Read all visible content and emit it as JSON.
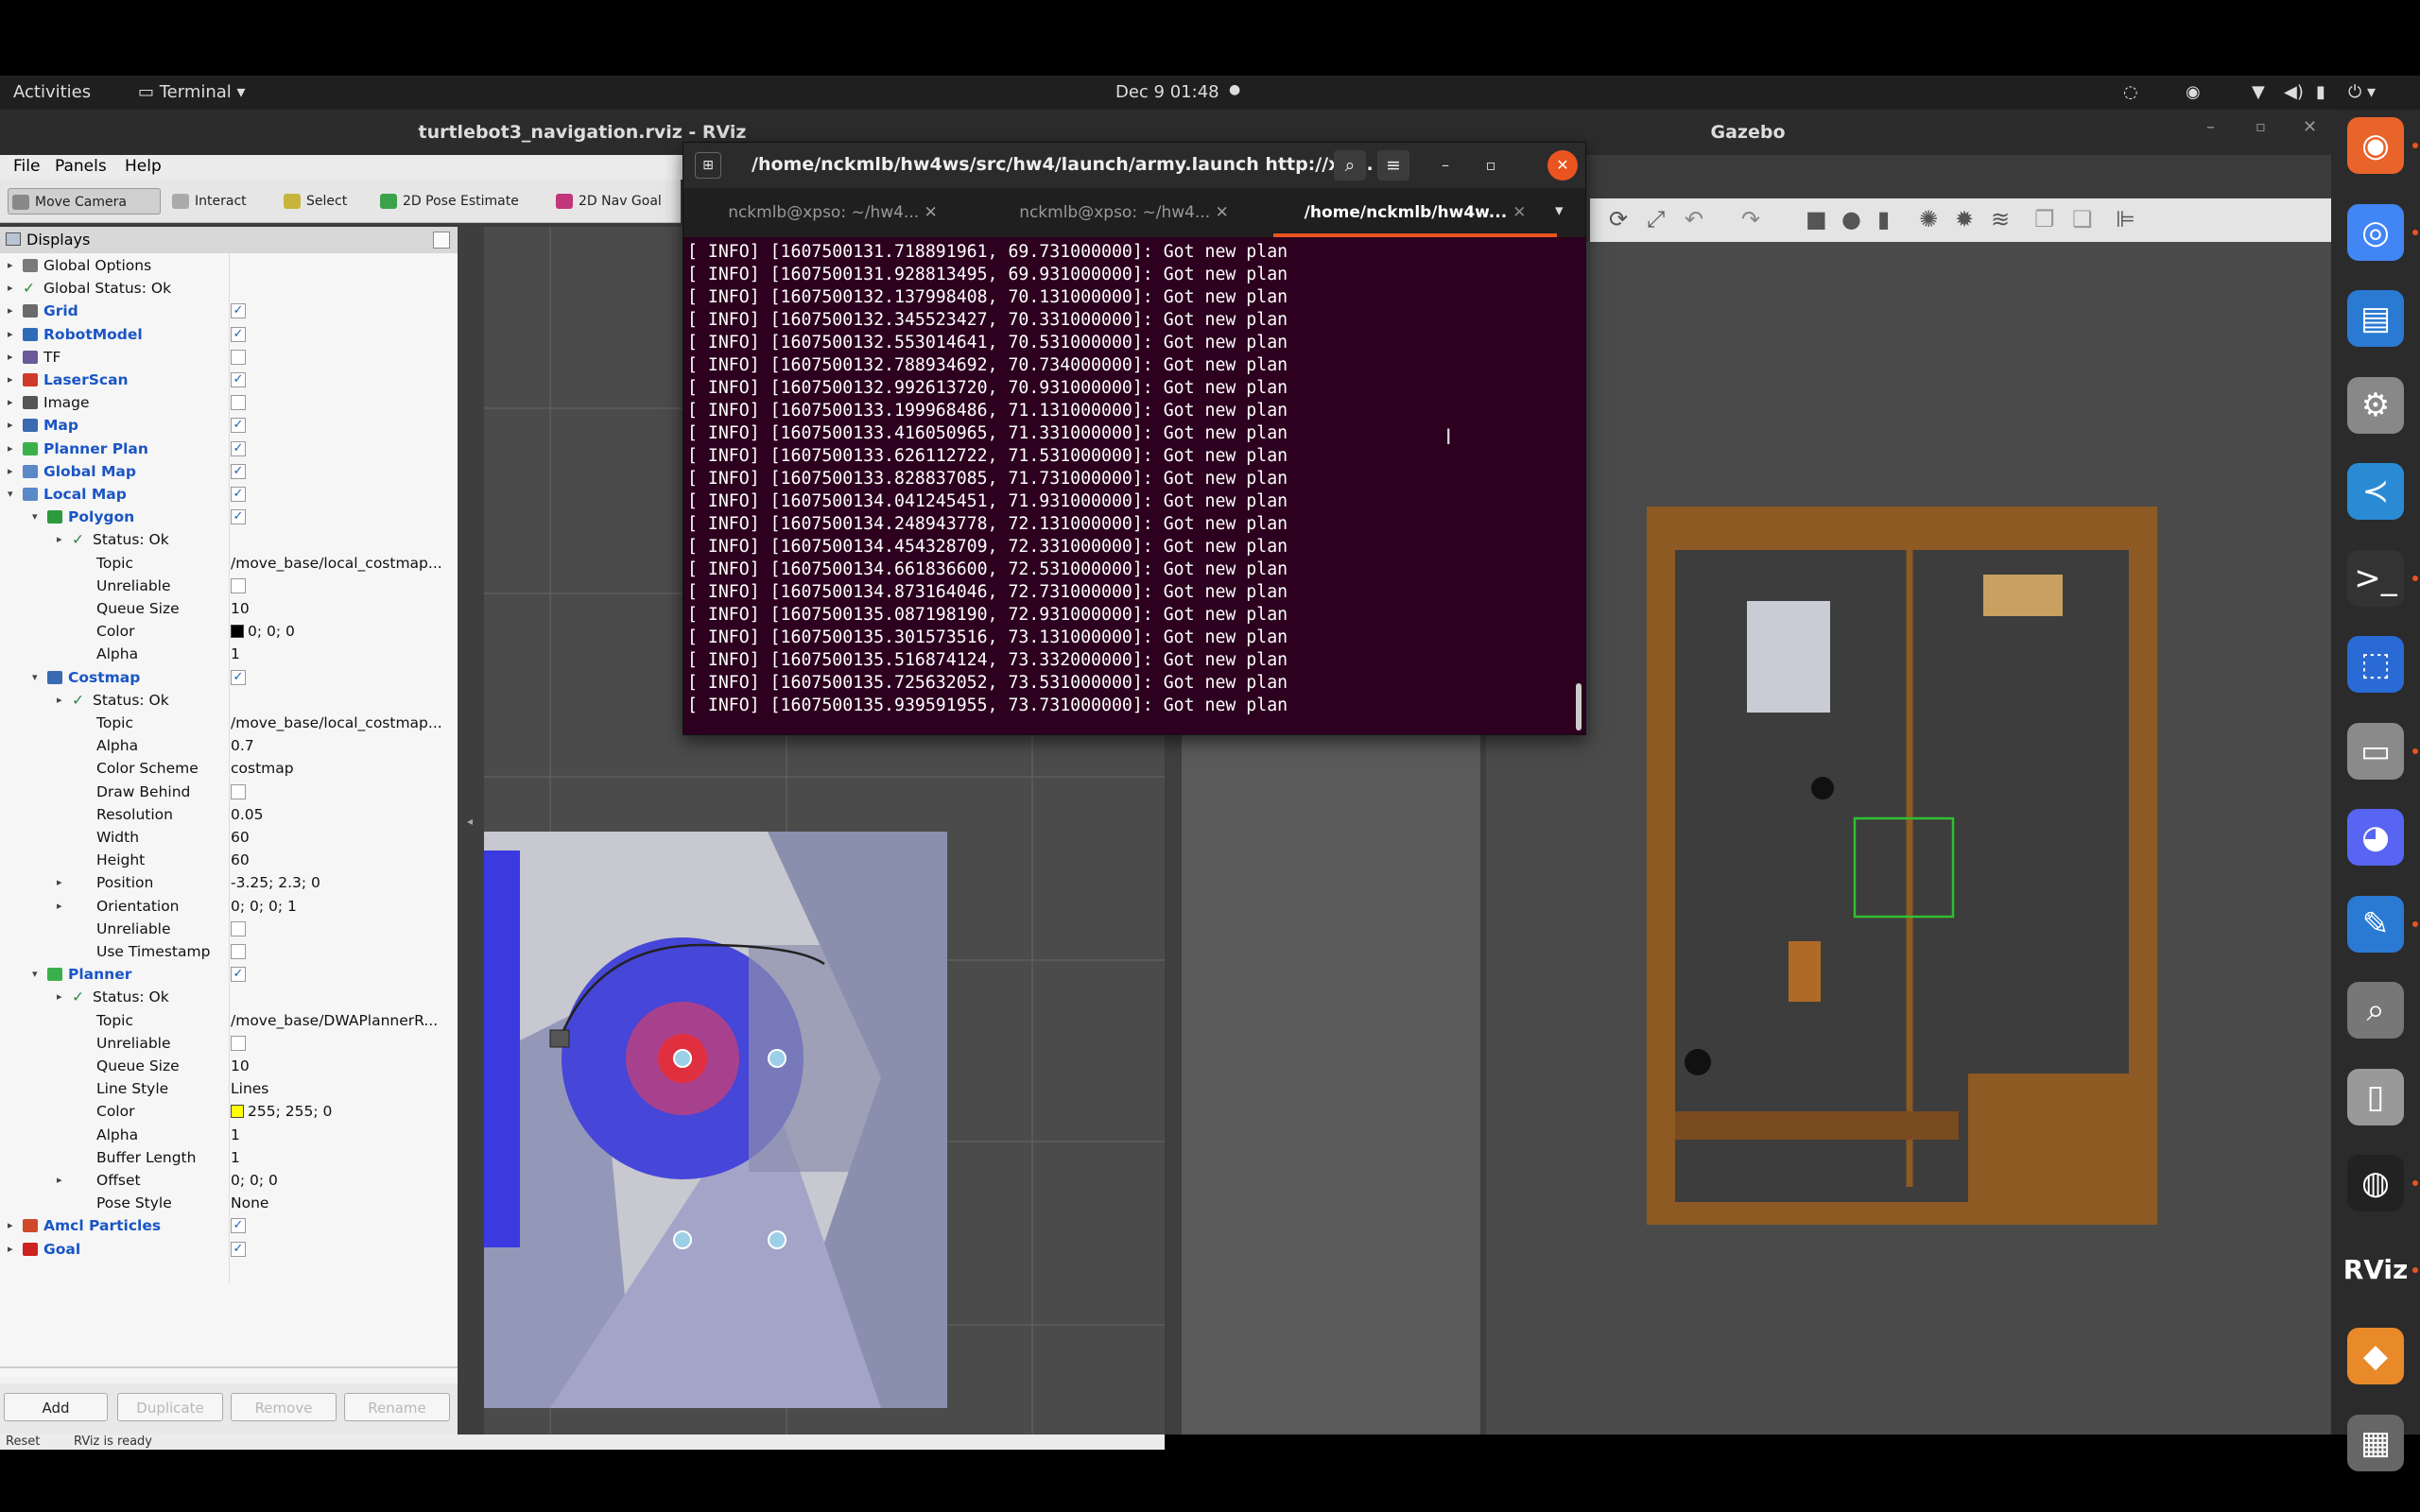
{
  "topbar": {
    "activities": "Activities",
    "app": "Terminal",
    "clock": "Dec 9  01:48"
  },
  "rviz": {
    "title": "turtlebot3_navigation.rviz - RViz",
    "menu": [
      "File",
      "Panels",
      "Help"
    ],
    "tools": [
      "Move Camera",
      "Interact",
      "Select",
      "2D Pose Estimate",
      "2D Nav Goal"
    ],
    "displays_title": "Displays",
    "buttons": {
      "add": "Add",
      "duplicate": "Duplicate",
      "remove": "Remove",
      "rename": "Rename"
    },
    "status": {
      "reset": "Reset",
      "message": "RViz is ready"
    },
    "tree": [
      {
        "label": "Global Options",
        "indent": 0,
        "type": "item",
        "icon": "gear"
      },
      {
        "label": "Global Status: Ok",
        "indent": 0,
        "type": "item",
        "icon": "check"
      },
      {
        "label": "Grid",
        "indent": 0,
        "type": "display",
        "checked": true,
        "icon": "grid"
      },
      {
        "label": "RobotModel",
        "indent": 0,
        "type": "display",
        "checked": true,
        "icon": "robot"
      },
      {
        "label": "TF",
        "indent": 0,
        "type": "plain",
        "checked": false,
        "icon": "tf"
      },
      {
        "label": "LaserScan",
        "indent": 0,
        "type": "display",
        "checked": true,
        "icon": "laser"
      },
      {
        "label": "Image",
        "indent": 0,
        "type": "plain",
        "checked": false,
        "icon": "image"
      },
      {
        "label": "Map",
        "indent": 0,
        "type": "display",
        "checked": true,
        "icon": "map"
      },
      {
        "label": "Planner Plan",
        "indent": 0,
        "type": "display",
        "checked": true,
        "icon": "path"
      },
      {
        "label": "Global Map",
        "indent": 0,
        "type": "display",
        "checked": true,
        "icon": "folder"
      },
      {
        "label": "Local Map",
        "indent": 0,
        "type": "display",
        "checked": true,
        "icon": "folder",
        "open": true
      },
      {
        "label": "Polygon",
        "indent": 1,
        "type": "display",
        "checked": true,
        "icon": "polygon",
        "open": true
      },
      {
        "label": "Status: Ok",
        "indent": 2,
        "type": "item",
        "icon": "check"
      },
      {
        "label": "Topic",
        "indent": 2,
        "type": "prop",
        "value": "/move_base/local_costmap..."
      },
      {
        "label": "Unreliable",
        "indent": 2,
        "type": "propcb",
        "checked": false
      },
      {
        "label": "Queue Size",
        "indent": 2,
        "type": "prop",
        "value": "10"
      },
      {
        "label": "Color",
        "indent": 2,
        "type": "prop",
        "value": "0; 0; 0",
        "swatch": "#000000"
      },
      {
        "label": "Alpha",
        "indent": 2,
        "type": "prop",
        "value": "1"
      },
      {
        "label": "Costmap",
        "indent": 1,
        "type": "display",
        "checked": true,
        "icon": "map",
        "open": true
      },
      {
        "label": "Status: Ok",
        "indent": 2,
        "type": "item",
        "icon": "check"
      },
      {
        "label": "Topic",
        "indent": 2,
        "type": "prop",
        "value": "/move_base/local_costmap..."
      },
      {
        "label": "Alpha",
        "indent": 2,
        "type": "prop",
        "value": "0.7"
      },
      {
        "label": "Color Scheme",
        "indent": 2,
        "type": "prop",
        "value": "costmap"
      },
      {
        "label": "Draw Behind",
        "indent": 2,
        "type": "propcb",
        "checked": false
      },
      {
        "label": "Resolution",
        "indent": 2,
        "type": "prop",
        "value": "0.05"
      },
      {
        "label": "Width",
        "indent": 2,
        "type": "prop",
        "value": "60"
      },
      {
        "label": "Height",
        "indent": 2,
        "type": "prop",
        "value": "60"
      },
      {
        "label": "Position",
        "indent": 2,
        "type": "prop",
        "value": "-3.25; 2.3; 0",
        "expand": true
      },
      {
        "label": "Orientation",
        "indent": 2,
        "type": "prop",
        "value": "0; 0; 0; 1",
        "expand": true
      },
      {
        "label": "Unreliable",
        "indent": 2,
        "type": "propcb",
        "checked": false
      },
      {
        "label": "Use Timestamp",
        "indent": 2,
        "type": "propcb",
        "checked": false
      },
      {
        "label": "Planner",
        "indent": 1,
        "type": "display",
        "checked": true,
        "icon": "path",
        "open": true
      },
      {
        "label": "Status: Ok",
        "indent": 2,
        "type": "item",
        "icon": "check"
      },
      {
        "label": "Topic",
        "indent": 2,
        "type": "prop",
        "value": "/move_base/DWAPlannerR..."
      },
      {
        "label": "Unreliable",
        "indent": 2,
        "type": "propcb",
        "checked": false
      },
      {
        "label": "Queue Size",
        "indent": 2,
        "type": "prop",
        "value": "10"
      },
      {
        "label": "Line Style",
        "indent": 2,
        "type": "prop",
        "value": "Lines"
      },
      {
        "label": "Color",
        "indent": 2,
        "type": "prop",
        "value": "255; 255; 0",
        "swatch": "#ffff00"
      },
      {
        "label": "Alpha",
        "indent": 2,
        "type": "prop",
        "value": "1"
      },
      {
        "label": "Buffer Length",
        "indent": 2,
        "type": "prop",
        "value": "1"
      },
      {
        "label": "Offset",
        "indent": 2,
        "type": "prop",
        "value": "0; 0; 0",
        "expand": true
      },
      {
        "label": "Pose Style",
        "indent": 2,
        "type": "prop",
        "value": "None"
      },
      {
        "label": "Amcl Particles",
        "indent": 0,
        "type": "display",
        "checked": true,
        "icon": "particles"
      },
      {
        "label": "Goal",
        "indent": 0,
        "type": "display",
        "checked": true,
        "icon": "goal"
      }
    ]
  },
  "terminal": {
    "title": "/home/nckmlb/hw4ws/src/hw4/launch/army.launch http://xp...",
    "tabs": [
      "nckmlb@xpso: ~/hw4...",
      "nckmlb@xpso: ~/hw4...",
      "/home/nckmlb/hw4w..."
    ],
    "lines": [
      "[ INFO] [1607500131.718891961, 69.731000000]: Got new plan",
      "[ INFO] [1607500131.928813495, 69.931000000]: Got new plan",
      "[ INFO] [1607500132.137998408, 70.131000000]: Got new plan",
      "[ INFO] [1607500132.345523427, 70.331000000]: Got new plan",
      "[ INFO] [1607500132.553014641, 70.531000000]: Got new plan",
      "[ INFO] [1607500132.788934692, 70.734000000]: Got new plan",
      "[ INFO] [1607500132.992613720, 70.931000000]: Got new plan",
      "[ INFO] [1607500133.199968486, 71.131000000]: Got new plan",
      "[ INFO] [1607500133.416050965, 71.331000000]: Got new plan",
      "[ INFO] [1607500133.626112722, 71.531000000]: Got new plan",
      "[ INFO] [1607500133.828837085, 71.731000000]: Got new plan",
      "[ INFO] [1607500134.041245451, 71.931000000]: Got new plan",
      "[ INFO] [1607500134.248943778, 72.131000000]: Got new plan",
      "[ INFO] [1607500134.454328709, 72.331000000]: Got new plan",
      "[ INFO] [1607500134.661836600, 72.531000000]: Got new plan",
      "[ INFO] [1607500134.873164046, 72.731000000]: Got new plan",
      "[ INFO] [1607500135.087198190, 72.931000000]: Got new plan",
      "[ INFO] [1607500135.301573516, 73.131000000]: Got new plan",
      "[ INFO] [1607500135.516874124, 73.332000000]: Got new plan",
      "[ INFO] [1607500135.725632052, 73.531000000]: Got new plan",
      "[ INFO] [1607500135.939591955, 73.731000000]: Got new plan"
    ]
  },
  "gazebo": {
    "title": "Gazebo"
  },
  "dock": [
    "firefox-icon",
    "chrome-icon",
    "text-editor-icon",
    "settings-icon",
    "vscode-icon",
    "terminal-icon",
    "screenshot-icon",
    "files-icon",
    "discord-icon",
    "notes-icon",
    "image-viewer-icon",
    "usb-icon",
    "obs-icon",
    "rviz-icon",
    "layers-icon",
    "trash-icon"
  ],
  "dock_rviz_label": "RViz",
  "colors": {
    "terminal_bg": "#2c001e",
    "accent": "#e95420",
    "costmap_blue": "#3b3bd6",
    "gazebo_bg": "#4a4a4a"
  }
}
